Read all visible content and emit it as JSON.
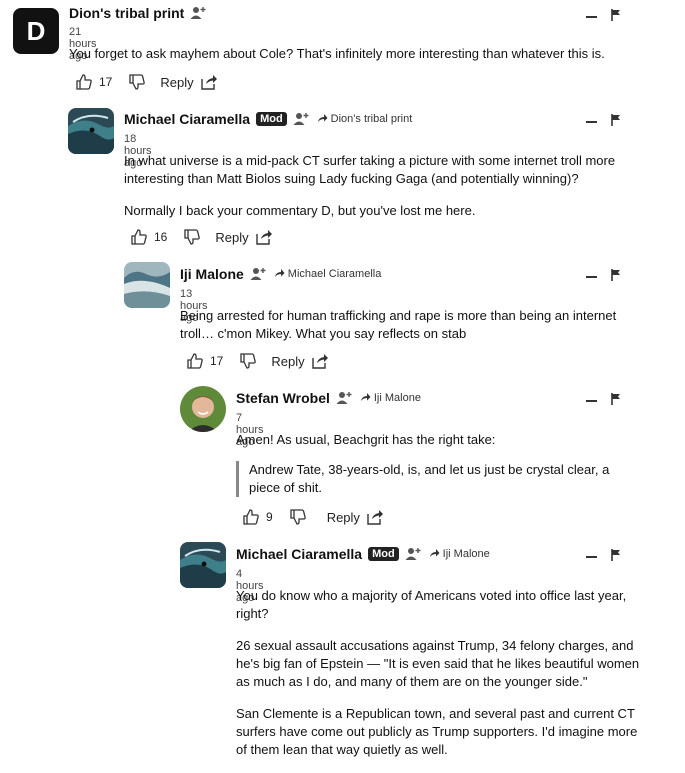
{
  "comments": [
    {
      "author": "Dion's tribal print",
      "avatar_letter": "D",
      "time": "21 hours ago",
      "body": [
        "You forget to ask mayhem about Cole? That's infinitely more interesting than whatever this is."
      ],
      "likes": "17",
      "reply_label": "Reply"
    },
    {
      "author": "Michael Ciaramella",
      "badge": "Mod",
      "reply_to": "Dion's tribal print",
      "time": "18 hours ago",
      "body": [
        "In what universe is a mid-pack CT surfer taking a picture with some internet troll more interesting than Matt Biolos suing Lady fucking Gaga (and potentially winning)?",
        "Normally I back your commentary D, but you've lost me here."
      ],
      "likes": "16",
      "reply_label": "Reply"
    },
    {
      "author": "Iji Malone",
      "reply_to": "Michael Ciaramella",
      "time": "13 hours ago",
      "body": [
        "Being arrested for human trafficking and rape is more than being an internet troll… c'mon Mikey. What you say reflects on stab"
      ],
      "likes": "17",
      "reply_label": "Reply"
    },
    {
      "author": "Stefan Wrobel",
      "reply_to": "Iji Malone",
      "time": "7 hours ago",
      "body": [
        "Amen! As usual, Beachgrit has the right take:"
      ],
      "quote": "Andrew Tate, 38-years-old, is, and let us just be crystal clear, a piece of shit.",
      "likes": "9",
      "reply_label": "Reply"
    },
    {
      "author": "Michael Ciaramella",
      "badge": "Mod",
      "reply_to": "Iji Malone",
      "time": "4 hours ago",
      "body": [
        "You do know who a majority of Americans voted into office last year, right?",
        "26 sexual assault accusations against Trump, 34 felony charges, and he's big fan of Epstein — \"It is even said that he likes beautiful women as much as I do, and many of them are on the younger side.\"",
        "San Clemente is a Republican town, and several past and current CT surfers have come out publicly as Trump supporters. I'd imagine more of them lean that way quietly as well."
      ]
    }
  ],
  "colors": {
    "text": "#111111",
    "badge_bg": "#222222",
    "quote_bar": "#888888"
  },
  "icons": [
    "follow-icon",
    "reply-arrow-icon",
    "thumbs-up-icon",
    "thumbs-down-icon",
    "share-icon",
    "collapse-icon",
    "flag-icon"
  ]
}
